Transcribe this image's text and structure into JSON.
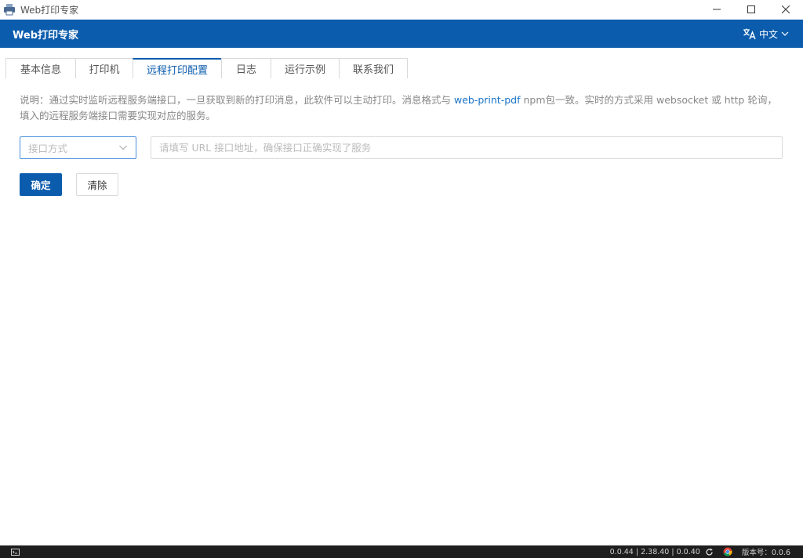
{
  "window": {
    "title": "Web打印专家"
  },
  "appbar": {
    "title": "Web打印专家",
    "language": "中文"
  },
  "tabs": [
    {
      "label": "基本信息"
    },
    {
      "label": "打印机"
    },
    {
      "label": "远程打印配置",
      "active": true
    },
    {
      "label": "日志"
    },
    {
      "label": "运行示例"
    },
    {
      "label": "联系我们"
    }
  ],
  "content": {
    "description_pre": "说明：通过实时监听远程服务端接口，一旦获取到新的打印消息，此软件可以主动打印。消息格式与 ",
    "description_link": "web-print-pdf",
    "description_post": " npm包一致。实时的方式采用 websocket 或 http 轮询，填入的远程服务端接口需要实现对应的服务。",
    "select_placeholder": "接口方式",
    "url_placeholder": "请填写 URL 接口地址，确保接口正确实现了服务",
    "confirm_label": "确定",
    "clear_label": "清除"
  },
  "statusbar": {
    "versions": "0.0.44 | 2.38.40 | 0.0.40",
    "version_label": "版本号：0.0.6"
  },
  "colors": {
    "accent": "#0b5cad",
    "link": "#1a73c7"
  }
}
